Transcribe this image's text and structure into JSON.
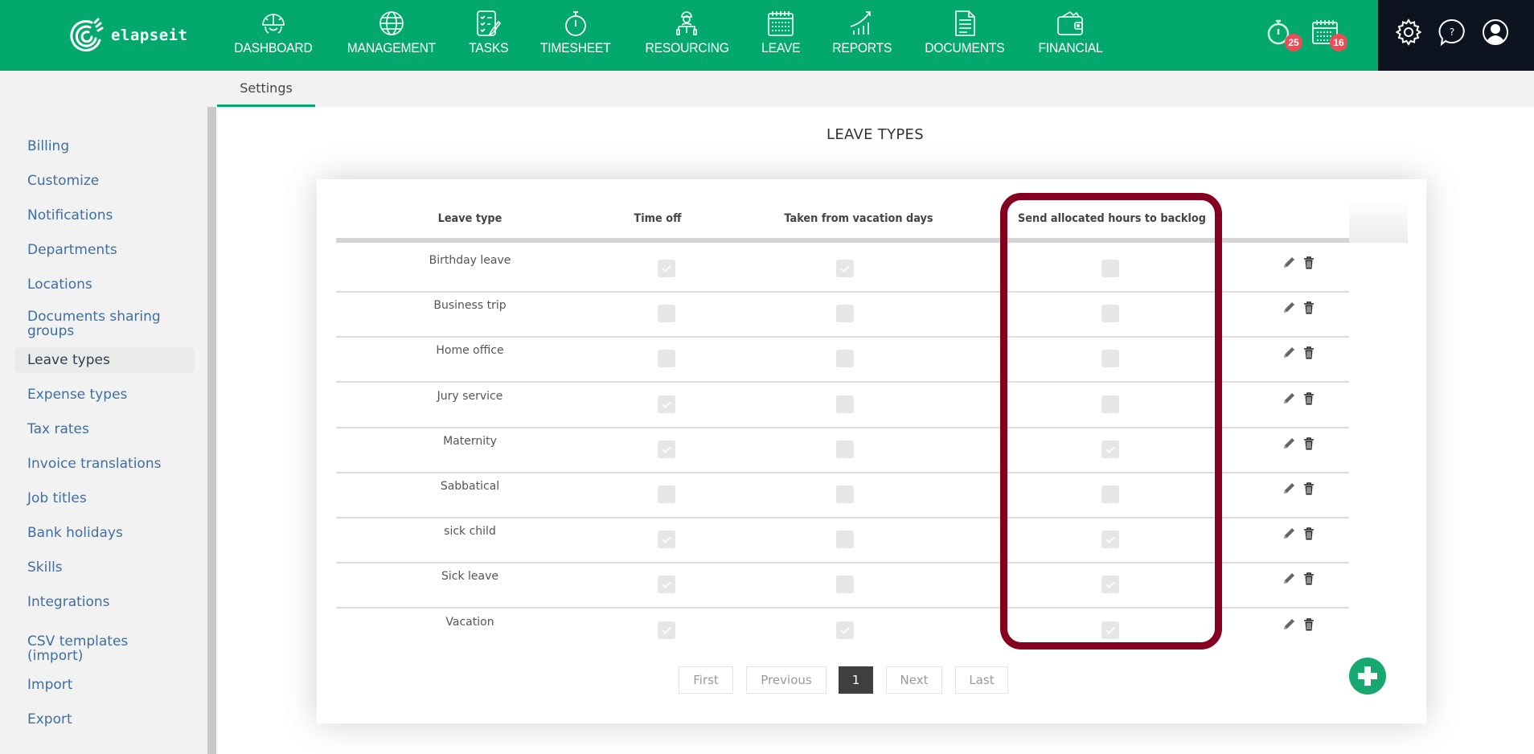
{
  "app": {
    "logo_text": "elapseit",
    "nav": [
      {
        "label": "DASHBOARD",
        "icon": "dashboard-gauge-icon"
      },
      {
        "label": "MANAGEMENT",
        "icon": "globe-icon"
      },
      {
        "label": "TASKS",
        "icon": "checklist-icon"
      },
      {
        "label": "TIMESHEET",
        "icon": "stopwatch-icon"
      },
      {
        "label": "RESOURCING",
        "icon": "worker-icon"
      },
      {
        "label": "LEAVE",
        "icon": "calendar-icon"
      },
      {
        "label": "REPORTS",
        "icon": "growth-chart-icon"
      },
      {
        "label": "DOCUMENTS",
        "icon": "document-icon"
      },
      {
        "label": "FINANCIAL",
        "icon": "wallet-icon"
      }
    ],
    "timer_badge": "25",
    "calendar_badge": "16",
    "brand_color": "#03a96c",
    "dark_color": "#0e1320"
  },
  "subtabs": {
    "active": "Settings"
  },
  "sidebar": {
    "items": [
      {
        "label": "Billing"
      },
      {
        "label": "Customize"
      },
      {
        "label": "Notifications"
      },
      {
        "label": "Departments"
      },
      {
        "label": "Locations"
      },
      {
        "label": "Documents sharing groups"
      },
      {
        "label": "Leave types",
        "active": true
      },
      {
        "label": "Expense types"
      },
      {
        "label": "Tax rates"
      },
      {
        "label": "Invoice translations"
      },
      {
        "label": "Job titles"
      },
      {
        "label": "Bank holidays"
      },
      {
        "label": "Skills"
      },
      {
        "label": "Integrations"
      },
      {
        "label": "CSV templates (import)"
      },
      {
        "label": "Import"
      },
      {
        "label": "Export"
      }
    ]
  },
  "main": {
    "title": "LEAVE TYPES",
    "columns": [
      "Leave type",
      "Time off",
      "Taken from vacation days",
      "Send allocated hours to backlog"
    ],
    "rows": [
      {
        "name": "Birthday leave",
        "time_off": true,
        "from_vacation": true,
        "to_backlog": false
      },
      {
        "name": "Business trip",
        "time_off": false,
        "from_vacation": false,
        "to_backlog": false
      },
      {
        "name": "Home office",
        "time_off": false,
        "from_vacation": false,
        "to_backlog": false
      },
      {
        "name": "Jury service",
        "time_off": true,
        "from_vacation": false,
        "to_backlog": false
      },
      {
        "name": "Maternity",
        "time_off": true,
        "from_vacation": false,
        "to_backlog": true
      },
      {
        "name": "Sabbatical",
        "time_off": false,
        "from_vacation": false,
        "to_backlog": false
      },
      {
        "name": "sick child",
        "time_off": true,
        "from_vacation": false,
        "to_backlog": true
      },
      {
        "name": "Sick leave",
        "time_off": true,
        "from_vacation": false,
        "to_backlog": true
      },
      {
        "name": "Vacation",
        "time_off": true,
        "from_vacation": true,
        "to_backlog": true
      }
    ],
    "pagination": {
      "first": "First",
      "previous": "Previous",
      "current": "1",
      "next": "Next",
      "last": "Last"
    },
    "highlight_color": "#850020"
  }
}
